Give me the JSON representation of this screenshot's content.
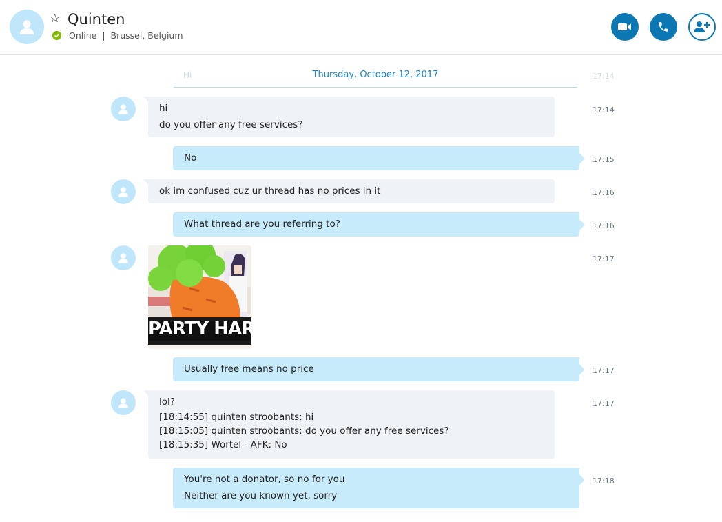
{
  "header": {
    "name": "Quinten",
    "status": "Online",
    "separator": "|",
    "location": "Brussel, Belgium"
  },
  "date_separator": {
    "ghost_text": "Hi",
    "date": "Thursday, October 12, 2017",
    "ghost_time": "17:14"
  },
  "messages": [
    {
      "direction": "in",
      "lines": [
        "hi",
        "do you offer any free services?"
      ],
      "time": "17:14"
    },
    {
      "direction": "out",
      "lines": [
        "No"
      ],
      "time": "17:15"
    },
    {
      "direction": "in",
      "lines": [
        "ok im confused cuz ur thread has no prices in it"
      ],
      "time": "17:16"
    },
    {
      "direction": "out",
      "lines": [
        "What thread are you referring to?"
      ],
      "time": "17:16"
    },
    {
      "direction": "in",
      "image": {
        "caption": "PARTY HARD"
      },
      "time": "17:17"
    },
    {
      "direction": "out",
      "lines": [
        "Usually free means no price"
      ],
      "time": "17:17"
    },
    {
      "direction": "in",
      "lines": [
        "lol?",
        "[18:14:55] quinten stroobants: hi",
        "[18:15:05] quinten stroobants: do you offer any free services?",
        "[18:15:35] Wortel - AFK: No"
      ],
      "time": "17:17"
    },
    {
      "direction": "out",
      "lines": [
        "You're not a donator, so no for you",
        "Neither are you known yet, sorry"
      ],
      "time": "17:18"
    }
  ],
  "colors": {
    "accent": "#0b78b3",
    "incoming": "#eff2f6",
    "outgoing": "#c7ebfb",
    "online": "#7fba00",
    "avatar": "#bfe6fb"
  },
  "icons": {
    "favorite": "star-outline-icon",
    "video": "video-camera-icon",
    "call": "phone-icon",
    "add": "add-person-icon"
  }
}
